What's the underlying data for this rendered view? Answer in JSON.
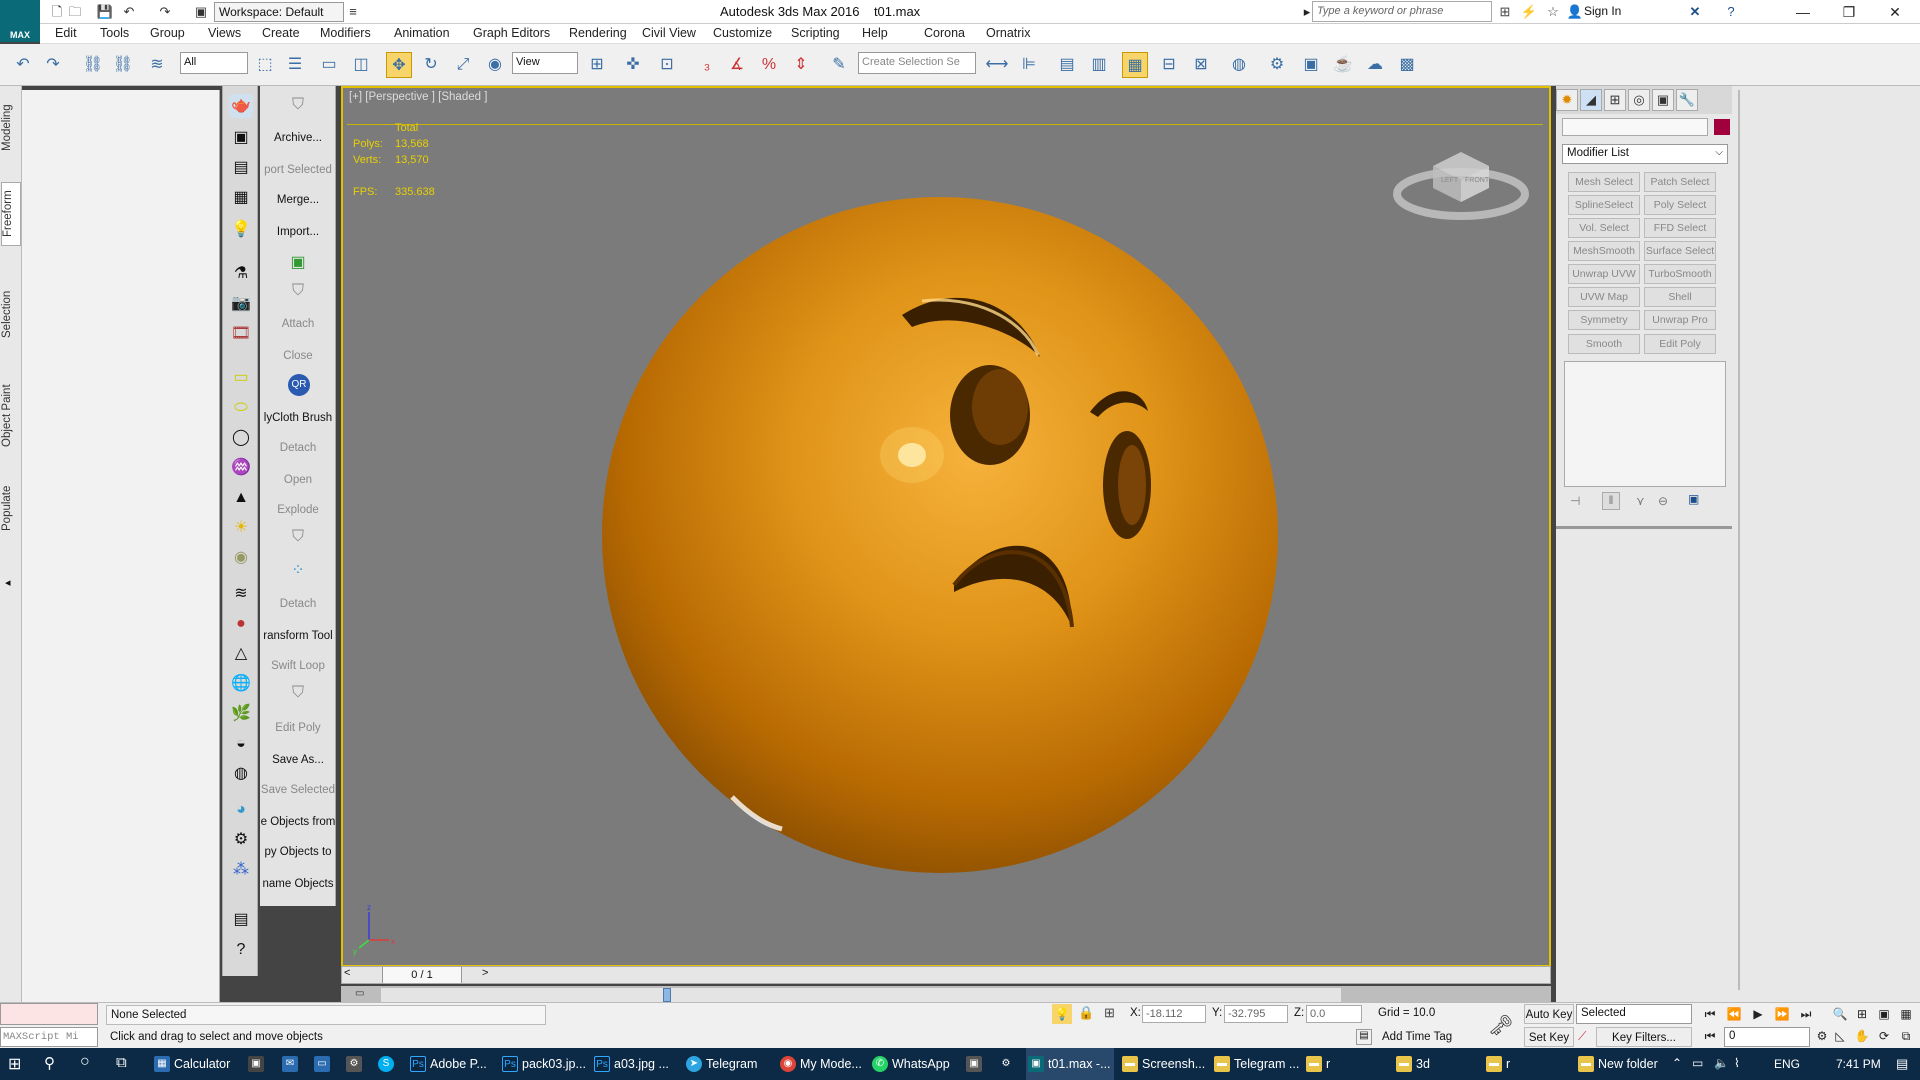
{
  "app": {
    "logo_label": "MAX",
    "workspace": "Workspace: Default",
    "title": "Autodesk 3ds Max 2016",
    "filename": "t01.max",
    "search_placeholder": "Type a keyword or phrase",
    "sign_in": "Sign In"
  },
  "menu": [
    "Edit",
    "Tools",
    "Group",
    "Views",
    "Create",
    "Modifiers",
    "Animation",
    "Graph Editors",
    "Rendering",
    "Civil View",
    "Customize",
    "Scripting",
    "Help",
    "Corona",
    "Ornatrix"
  ],
  "toolbar": {
    "filter_value": "All",
    "ref_coord": "View",
    "selection_set_placeholder": "Create Selection Se"
  },
  "ribbon_tabs": [
    "Modeling",
    "Freeform",
    "Selection",
    "Object Paint",
    "Populate"
  ],
  "commands": [
    {
      "label": "Archive...",
      "dim": false
    },
    {
      "label": "port Selected",
      "dim": true
    },
    {
      "label": "Merge...",
      "dim": false
    },
    {
      "label": "Import...",
      "dim": false
    },
    {
      "label": "Attach",
      "dim": true
    },
    {
      "label": "Close",
      "dim": true
    },
    {
      "label": "lyCloth Brush",
      "dim": false
    },
    {
      "label": "Detach",
      "dim": true
    },
    {
      "label": "Open",
      "dim": true
    },
    {
      "label": "Explode",
      "dim": true
    },
    {
      "label": "Detach",
      "dim": true
    },
    {
      "label": "ransform Tool",
      "dim": false
    },
    {
      "label": "Swift Loop",
      "dim": true
    },
    {
      "label": "Edit Poly",
      "dim": true
    },
    {
      "label": "Save As...",
      "dim": false
    },
    {
      "label": "Save Selected",
      "dim": true
    },
    {
      "label": "e Objects from",
      "dim": false
    },
    {
      "label": "py Objects to",
      "dim": false
    },
    {
      "label": "name Objects",
      "dim": false
    }
  ],
  "viewport": {
    "label": "[+] [Perspective ] [Shaded ]",
    "stats_header": "Total",
    "polys_label": "Polys:",
    "polys_value": "13,568",
    "verts_label": "Verts:",
    "verts_value": "13,570",
    "fps_label": "FPS:",
    "fps_value": "335.638",
    "viewcube_left": "LEFT",
    "viewcube_front": "FRONT",
    "object_color": "#e09418"
  },
  "timeline": {
    "position": "0 / 1"
  },
  "right_panel": {
    "modifier_list": "Modifier List",
    "object_color": "#a0003c",
    "modifiers": [
      "Mesh Select",
      "Patch Select",
      "SplineSelect",
      "Poly Select",
      "Vol. Select",
      "FFD Select",
      "MeshSmooth",
      "Surface Select",
      "Unwrap UVW",
      "TurboSmooth",
      "UVW Map",
      "Shell",
      "Symmetry",
      "Unwrap Pro",
      "Smooth",
      "Edit Poly"
    ]
  },
  "status": {
    "maxscript": "MAXScript Mi",
    "selection": "None Selected",
    "prompt": "Click and drag to select and move objects",
    "x_label": "X:",
    "x_value": "-18.112",
    "y_label": "Y:",
    "y_value": "-32.795",
    "z_label": "Z:",
    "z_value": "0.0",
    "grid": "Grid = 10.0",
    "add_time_tag": "Add Time Tag",
    "auto_key": "Auto Key",
    "set_key": "Set Key",
    "key_mode": "Selected",
    "key_filters": "Key Filters...",
    "frame": "0"
  },
  "taskbar": {
    "items": [
      "Calculator",
      "Adobe P...",
      "pack03.jp...",
      "a03.jpg ...",
      "Telegram",
      "My Mode...",
      "WhatsApp",
      "t01.max -...",
      "Screensh...",
      "Telegram ...",
      "r",
      "3d",
      "r",
      "New folder"
    ],
    "language": "ENG",
    "time": "7:41 PM"
  }
}
